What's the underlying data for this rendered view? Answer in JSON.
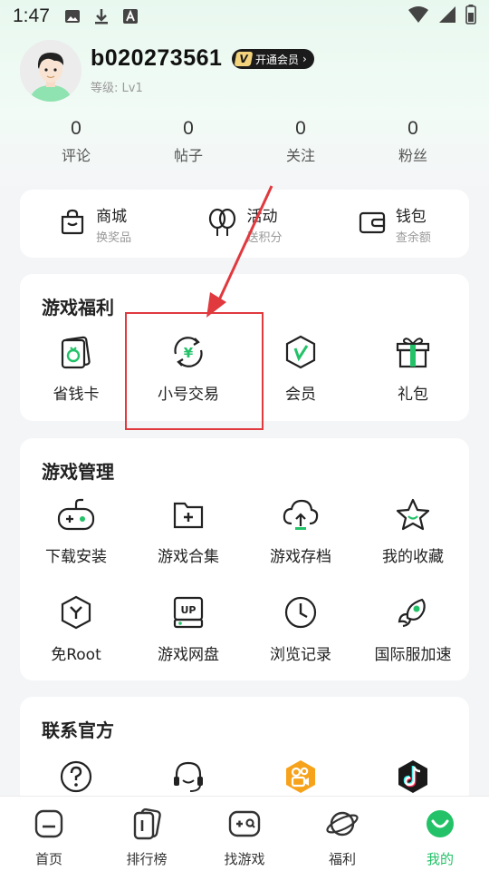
{
  "status_bar": {
    "time": "1:47"
  },
  "profile": {
    "username": "b020273561",
    "vip_label": "开通会员",
    "level": "等级: Lv1"
  },
  "stats": [
    {
      "value": "0",
      "label": "评论"
    },
    {
      "value": "0",
      "label": "帖子"
    },
    {
      "value": "0",
      "label": "关注"
    },
    {
      "value": "0",
      "label": "粉丝"
    }
  ],
  "quick": [
    {
      "title": "商城",
      "sub": "换奖品",
      "icon": "shopping-bag-icon"
    },
    {
      "title": "活动",
      "sub": "送积分",
      "icon": "balloon-icon"
    },
    {
      "title": "钱包",
      "sub": "查余额",
      "icon": "wallet-icon"
    }
  ],
  "welfare": {
    "title": "游戏福利",
    "items": [
      {
        "label": "省钱卡",
        "icon": "money-card-icon"
      },
      {
        "label": "小号交易",
        "icon": "yen-exchange-icon"
      },
      {
        "label": "会员",
        "icon": "vip-shield-icon"
      },
      {
        "label": "礼包",
        "icon": "gift-icon"
      }
    ]
  },
  "manage": {
    "title": "游戏管理",
    "items": [
      {
        "label": "下载安装",
        "icon": "gamepad-icon"
      },
      {
        "label": "游戏合集",
        "icon": "folder-plus-icon"
      },
      {
        "label": "游戏存档",
        "icon": "cloud-upload-icon"
      },
      {
        "label": "我的收藏",
        "icon": "star-icon"
      },
      {
        "label": "免Root",
        "icon": "hexagon-y-icon"
      },
      {
        "label": "游戏网盘",
        "icon": "up-disk-icon"
      },
      {
        "label": "浏览记录",
        "icon": "clock-icon"
      },
      {
        "label": "国际服加速",
        "icon": "rocket-icon"
      }
    ]
  },
  "contact": {
    "title": "联系官方",
    "items": [
      {
        "icon": "question-icon"
      },
      {
        "icon": "headset-icon"
      },
      {
        "icon": "kuaishou-icon"
      },
      {
        "icon": "tiktok-icon"
      }
    ]
  },
  "tabs": [
    {
      "label": "首页",
      "icon": "home-icon"
    },
    {
      "label": "排行榜",
      "icon": "ranking-icon"
    },
    {
      "label": "找游戏",
      "icon": "find-game-icon"
    },
    {
      "label": "福利",
      "icon": "planet-icon"
    },
    {
      "label": "我的",
      "icon": "smile-icon",
      "active": true
    }
  ],
  "colors": {
    "accent": "#23c268",
    "highlight": "#e0393e"
  }
}
